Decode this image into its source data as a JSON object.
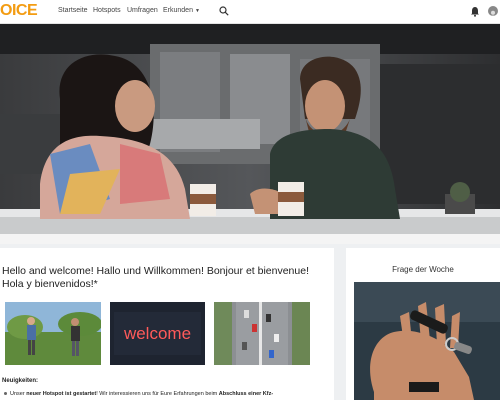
{
  "brand": {
    "logo_text": "OICE",
    "color": "#f39c12"
  },
  "nav": {
    "items": [
      {
        "label": "Startseite"
      },
      {
        "label": "Hotspots"
      },
      {
        "label": "Umfragen"
      },
      {
        "label": "Erkunden"
      }
    ],
    "search_icon": "search-icon",
    "bell_icon": "bell-icon",
    "user_icon": "user-avatar-icon"
  },
  "main": {
    "title": "Hello and welcome! Hallo und Willkommen! Bonjour et bienvenue! Hola y bienvenidos!*",
    "thumbnails": [
      {
        "name": "children-playing"
      },
      {
        "name": "welcome-neon-sign",
        "text": "welcome"
      },
      {
        "name": "city-traffic-aerial"
      }
    ],
    "news_label": "Neuigkeiten:",
    "news_items": [
      {
        "prefix": "Unser ",
        "bold1": "neuer Hotspot ist gestartet",
        "middle": "! Wir interessieren uns für Eure Erfahrungen beim ",
        "bold2": "Abschluss einer Kfz-"
      }
    ]
  },
  "sidebar": {
    "title": "Frage der Woche"
  }
}
